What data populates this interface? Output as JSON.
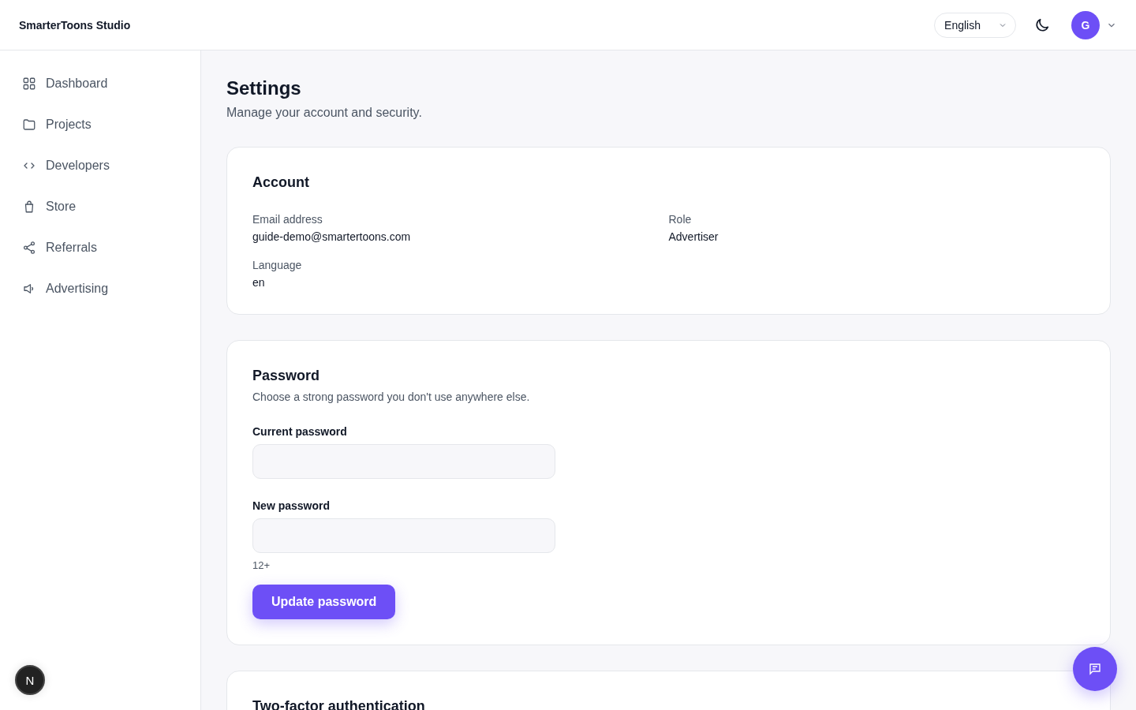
{
  "header": {
    "brand": "SmarterToons Studio",
    "language": "English",
    "avatar_initial": "G"
  },
  "sidebar": {
    "items": [
      {
        "label": "Dashboard",
        "selected": false
      },
      {
        "label": "Projects",
        "selected": false
      },
      {
        "label": "Developers",
        "selected": false
      },
      {
        "label": "Store",
        "selected": false
      },
      {
        "label": "Referrals",
        "selected": false
      },
      {
        "label": "Advertising",
        "selected": false
      }
    ]
  },
  "dev_badge": "N",
  "page": {
    "title": "Settings",
    "subtitle": "Manage your account and security."
  },
  "account": {
    "title": "Account",
    "fields": [
      {
        "label": "Email address",
        "value": "guide-demo@smartertoons.com"
      },
      {
        "label": "Role",
        "value": "Advertiser"
      },
      {
        "label": "Language",
        "value": "en"
      }
    ]
  },
  "password": {
    "title": "Password",
    "description": "Choose a strong password you don't use anywhere else.",
    "fields": [
      {
        "label": "Current password"
      },
      {
        "label": "New password",
        "hint": "12+"
      }
    ],
    "button": "Update password"
  },
  "two_factor": {
    "title": "Two-factor authentication"
  }
}
